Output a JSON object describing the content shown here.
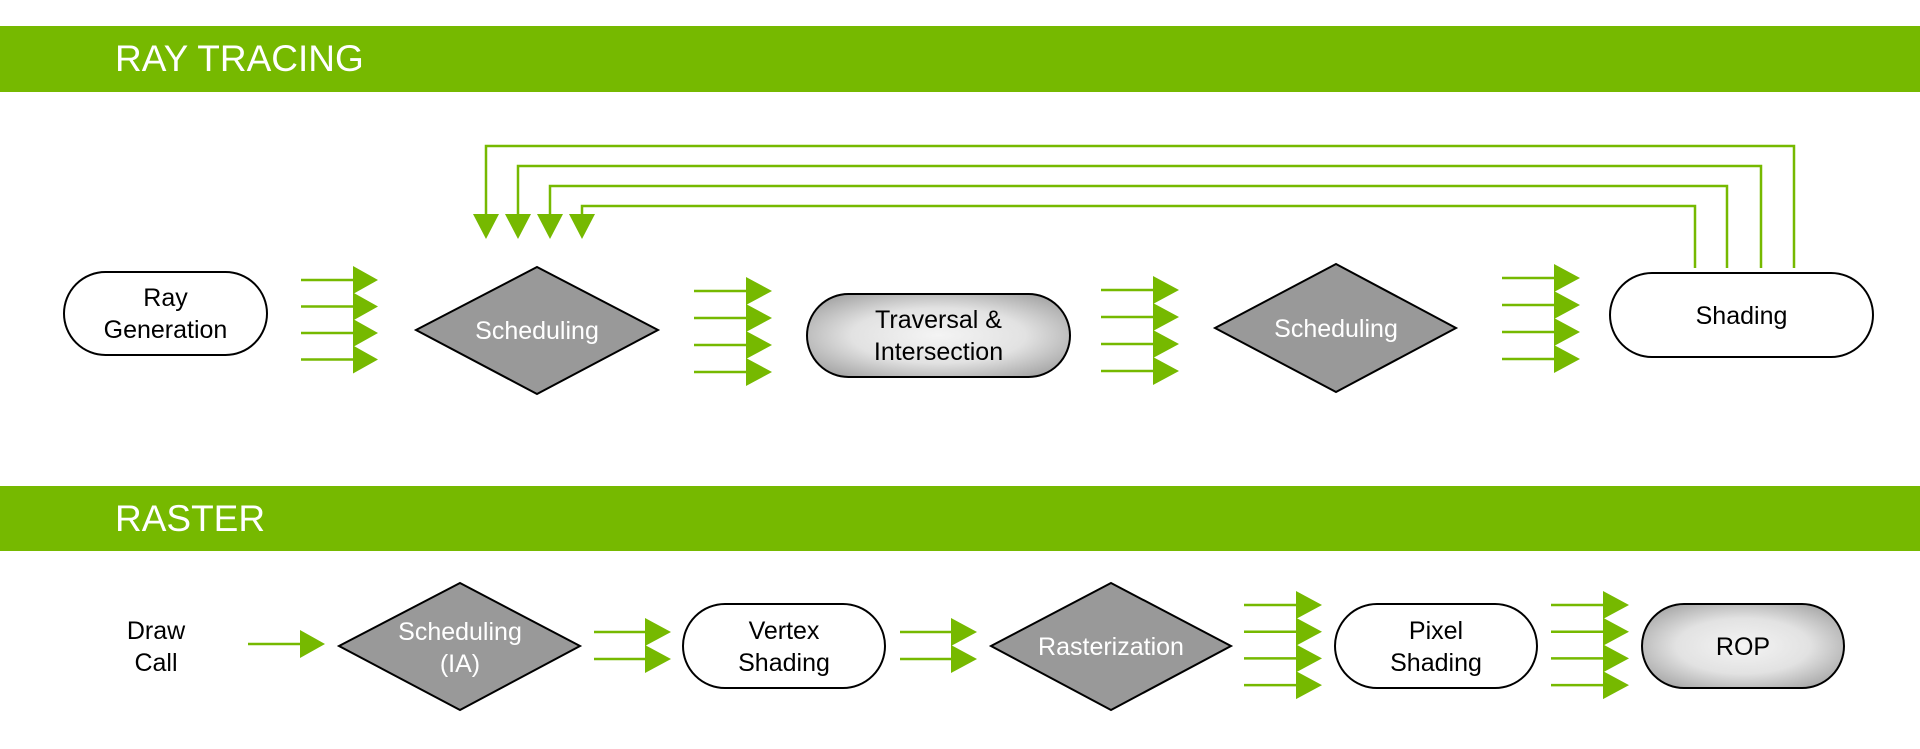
{
  "colors": {
    "accent_green": "#76b900",
    "diamond_fill": "#999999",
    "pill_fill": "#ffffff",
    "gradient_center": "#f4f4f4",
    "gradient_edge": "#a8a8a8"
  },
  "sections": {
    "ray_tracing": {
      "title": "RAY TRACING",
      "nodes": [
        {
          "id": "ray-generation",
          "shape": "pill",
          "style": "white",
          "lines": [
            "Ray",
            "Generation"
          ]
        },
        {
          "id": "scheduling-1",
          "shape": "diamond",
          "lines": [
            "Scheduling"
          ]
        },
        {
          "id": "traversal-intersection",
          "shape": "pill",
          "style": "gradient",
          "lines": [
            "Traversal &",
            "Intersection"
          ]
        },
        {
          "id": "scheduling-2",
          "shape": "diamond",
          "lines": [
            "Scheduling"
          ]
        },
        {
          "id": "shading",
          "shape": "pill",
          "style": "white",
          "lines": [
            "Shading"
          ]
        }
      ],
      "connectors": [
        {
          "from": "ray-generation",
          "to": "scheduling-1",
          "arrow_count": 4
        },
        {
          "from": "scheduling-1",
          "to": "traversal-intersection",
          "arrow_count": 4
        },
        {
          "from": "traversal-intersection",
          "to": "scheduling-2",
          "arrow_count": 4
        },
        {
          "from": "scheduling-2",
          "to": "shading",
          "arrow_count": 4
        }
      ],
      "feedback": {
        "from": "shading",
        "to": "scheduling-1",
        "loop_count": 4
      }
    },
    "raster": {
      "title": "RASTER",
      "nodes": [
        {
          "id": "draw-call",
          "shape": "text",
          "lines": [
            "Draw",
            "Call"
          ]
        },
        {
          "id": "scheduling-ia",
          "shape": "diamond",
          "lines": [
            "Scheduling",
            "(IA)"
          ]
        },
        {
          "id": "vertex-shading",
          "shape": "pill",
          "style": "white",
          "lines": [
            "Vertex",
            "Shading"
          ]
        },
        {
          "id": "rasterization",
          "shape": "diamond",
          "lines": [
            "Rasterization"
          ]
        },
        {
          "id": "pixel-shading",
          "shape": "pill",
          "style": "white",
          "lines": [
            "Pixel",
            "Shading"
          ]
        },
        {
          "id": "rop",
          "shape": "pill",
          "style": "gradient",
          "lines": [
            "ROP"
          ]
        }
      ],
      "connectors": [
        {
          "from": "draw-call",
          "to": "scheduling-ia",
          "arrow_count": 1
        },
        {
          "from": "scheduling-ia",
          "to": "vertex-shading",
          "arrow_count": 2
        },
        {
          "from": "vertex-shading",
          "to": "rasterization",
          "arrow_count": 2
        },
        {
          "from": "rasterization",
          "to": "pixel-shading",
          "arrow_count": 4
        },
        {
          "from": "pixel-shading",
          "to": "rop",
          "arrow_count": 4
        }
      ]
    }
  }
}
